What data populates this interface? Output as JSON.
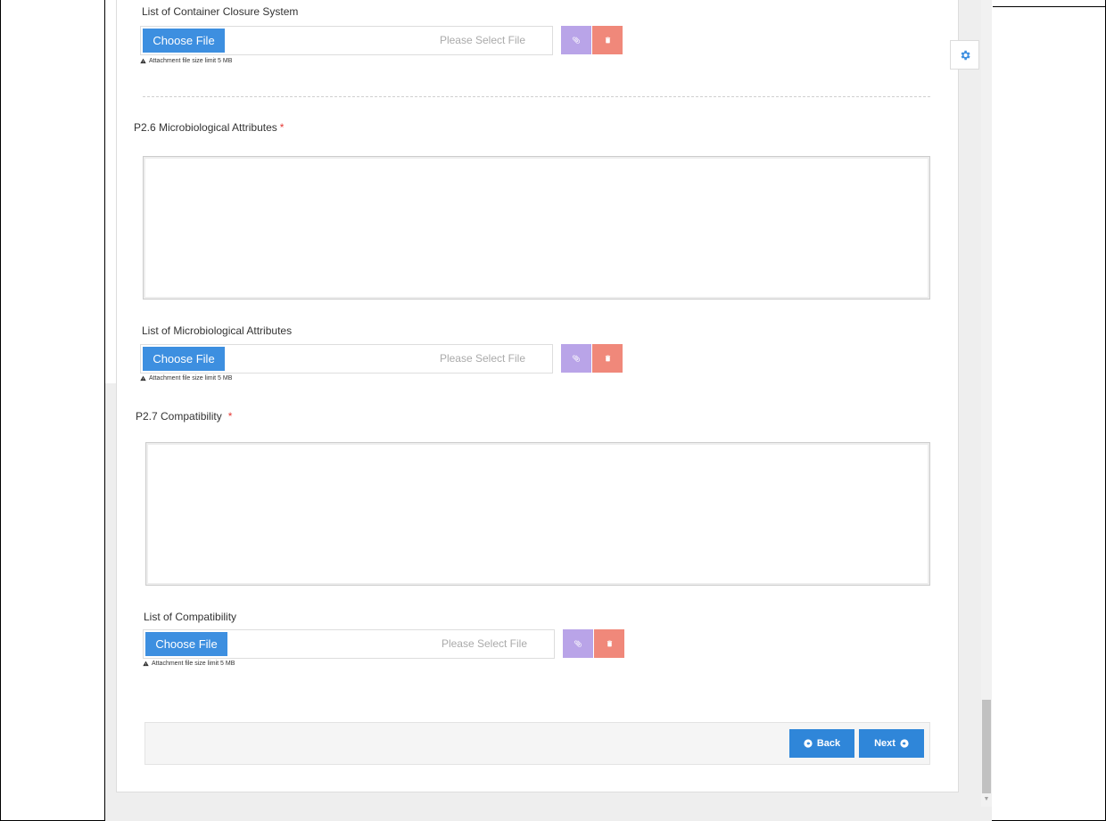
{
  "sections": {
    "container_closure": {
      "list_label": "List of Container Closure System",
      "choose_label": "Choose File",
      "placeholder": "Please Select File",
      "hint": "Attachment file size limit 5 MB"
    },
    "microbiological": {
      "title": "P2.6 Microbiological Attributes",
      "required_mark": "*",
      "list_label": "List of Microbiological Attributes",
      "choose_label": "Choose File",
      "placeholder": "Please Select File",
      "hint": "Attachment file size limit 5 MB"
    },
    "compatibility": {
      "title": "P2.7 Compatibility",
      "required_mark": "*",
      "list_label": "List of Compatibility",
      "choose_label": "Choose File",
      "placeholder": "Please Select File",
      "hint": "Attachment file size limit 5 MB"
    }
  },
  "footer": {
    "back_label": "Back",
    "next_label": "Next"
  },
  "colors": {
    "primary": "#3d8fe0",
    "attach": "#b9a4e8",
    "delete": "#f0887a",
    "required": "#e53935"
  },
  "icons": {
    "settings": "gear-icon",
    "attach": "paperclip-icon",
    "delete": "trash-icon",
    "warning": "warning-icon",
    "back": "circle-arrow-left-icon",
    "next": "circle-arrow-right-icon"
  }
}
